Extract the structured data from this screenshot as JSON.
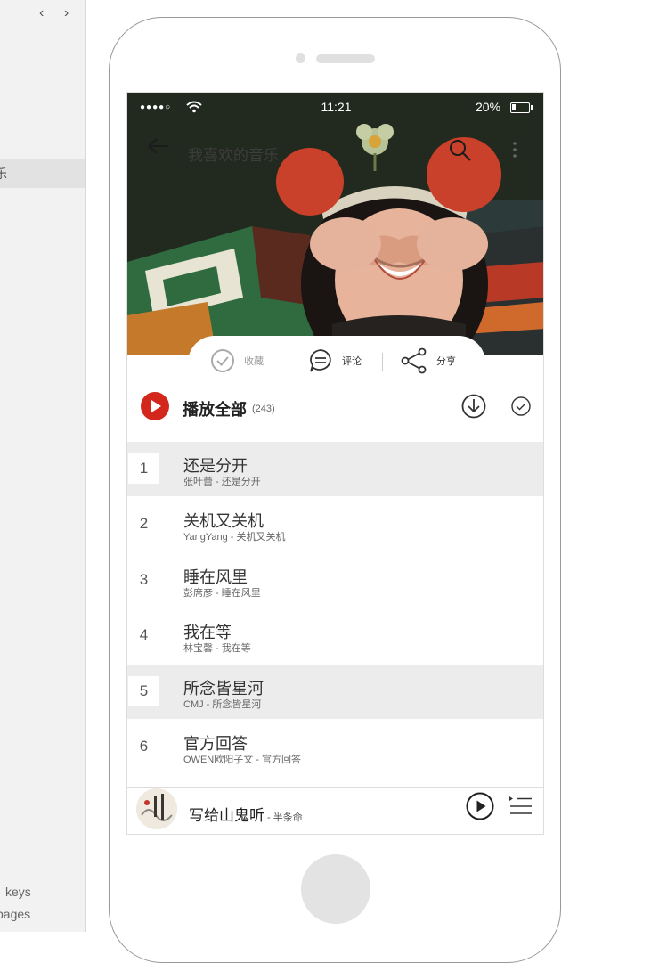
{
  "sidebar": {
    "back_arrow": "‹",
    "forward_arrow": "›",
    "selected_item_fragment": "乐",
    "bottom_items": [
      "keys",
      "pages"
    ]
  },
  "status": {
    "signal_dots": "●●●●○",
    "time": "11:21",
    "battery": "20%",
    "battery_level": 0.2
  },
  "header": {
    "title": "我喜欢的音乐",
    "icons": [
      "back-arrow-icon",
      "search-icon",
      "more-vertical-icon"
    ]
  },
  "actions": {
    "collect": "收藏",
    "comment": "评论",
    "share": "分享"
  },
  "play_all": {
    "label": "播放全部",
    "count": "(243)"
  },
  "songs": [
    {
      "num": "1",
      "title": "还是分开",
      "artist": "张叶蕾 - 还是分开",
      "highlighted": true
    },
    {
      "num": "2",
      "title": "关机又关机",
      "artist": "YangYang - 关机又关机",
      "highlighted": false
    },
    {
      "num": "3",
      "title": "睡在风里",
      "artist": "彭席彦 - 睡在风里",
      "highlighted": false
    },
    {
      "num": "4",
      "title": "我在等",
      "artist": "林宝馨 - 我在等",
      "highlighted": false
    },
    {
      "num": "5",
      "title": "所念皆星河",
      "artist": "CMJ - 所念皆星河",
      "highlighted": true
    },
    {
      "num": "6",
      "title": "官方回答",
      "artist": "OWEN欧阳子文 - 官方回答",
      "highlighted": false
    }
  ],
  "player": {
    "title": "写给山鬼听",
    "artist": " - 半条命"
  },
  "colors": {
    "accent_red": "#d4271c",
    "highlight_row": "#ececec",
    "sidebar_bg": "#f2f2f2"
  }
}
